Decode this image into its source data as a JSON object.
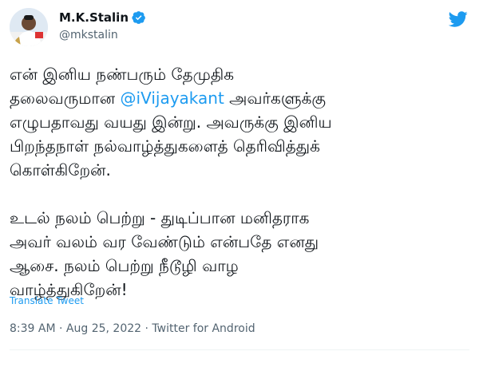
{
  "user": {
    "name": "M.K.Stalin",
    "handle": "@mkstalin",
    "verified_color": "#1d9bf0",
    "avatar_icon": "profile-photo"
  },
  "tweet": {
    "line1": "என் இனிய நண்பரும் தேமுதிக",
    "line2_prefix": "தலைவருமான ",
    "mention": "@iVijayakant",
    "line2_suffix": " அவர்களுக்கு",
    "line3": "எழுபதாவது வயது இன்று. அவருக்கு இனிய",
    "line4": "பிறந்தநாள் நல்வாழ்த்துகளைத் தெரிவித்துக்",
    "line5": "கொள்கிறேன்.",
    "p2_line1": "உடல் நலம் பெற்று - துடிப்பான மனிதராக",
    "p2_line2": "அவர் வலம் வர வேண்டும் என்பதே எனது",
    "p2_line3": "ஆசை. நலம் பெற்று நீடூழி வாழ",
    "p2_line4": "வாழ்த்துகிறேன்!"
  },
  "translate_label": "Translate Tweet",
  "meta": {
    "time": "8:39 AM",
    "sep1": " · ",
    "date": "Aug 25, 2022",
    "sep2": " · ",
    "source": "Twitter for Android"
  },
  "colors": {
    "accent": "#1d9bf0",
    "secondary_text": "#536471",
    "primary_text": "#0f1419"
  }
}
